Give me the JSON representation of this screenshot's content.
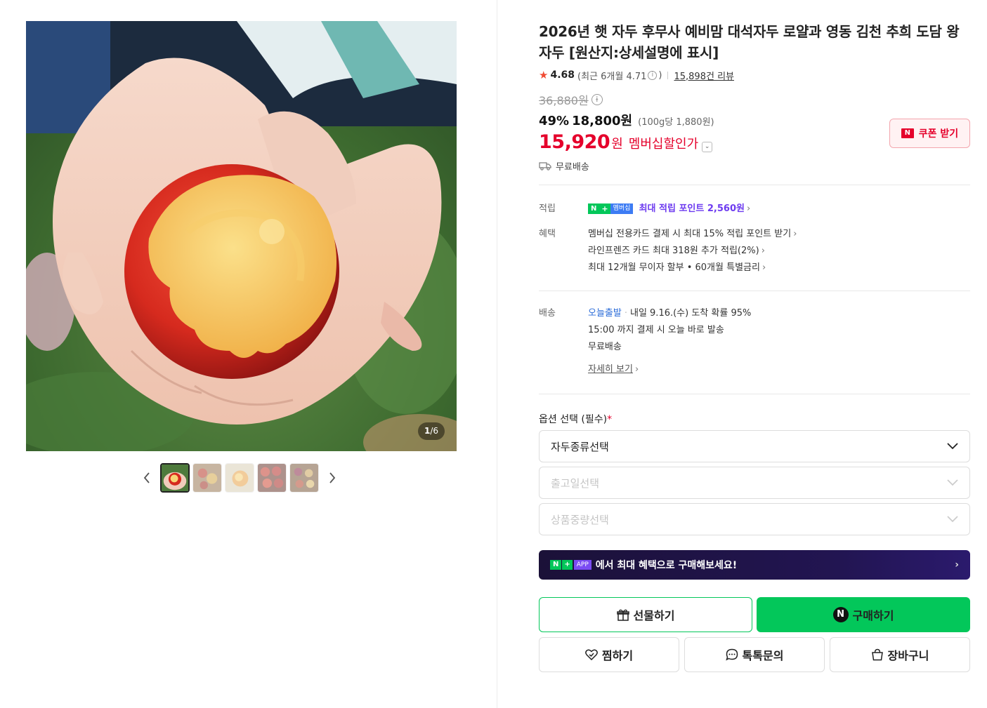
{
  "gallery": {
    "counter_current": "1",
    "counter_total": "/6",
    "thumbnail_count": 5
  },
  "product": {
    "title": "2026년 햇 자두 후무사 예비맘 대석자두 로얄과 영동 김천 추희 도담 왕자두 [원산지:상세설명에 표시]",
    "rating": "4.68",
    "rating_recent": "(최근 6개월 4.71",
    "rating_recent_close": ")",
    "review_count": "15,898건 리뷰",
    "original_price": "36,880원",
    "discount_rate": "49%",
    "sale_price": "18,800원",
    "unit_price": "(100g당 1,880원)",
    "member_price": "15,920",
    "member_won": "원",
    "member_label": "멤버십할인가",
    "shipping_summary": "무료배송",
    "coupon_label": "쿠폰 받기"
  },
  "benefits": {
    "points_label": "적립",
    "points_badge_n": "N",
    "points_badge_plus": "+",
    "points_badge_mem": "멤버십",
    "points_text": "최대 적립 포인트 2,560원",
    "perk_label": "혜택",
    "perks": [
      "멤버십 전용카드 결제 시 최대 15% 적립 포인트 받기",
      "라인프렌즈 카드 최대 318원 추가 적립(2%)",
      "최대 12개월 무이자 할부 • 60개월 특별금리"
    ]
  },
  "delivery": {
    "label": "배송",
    "today": "오늘출발",
    "arrival": "내일 9.16.(수) 도착 확률 95%",
    "cutoff": "15:00 까지 결제 시 오늘 바로 발송",
    "fee": "무료배송",
    "more": "자세히 보기"
  },
  "options": {
    "title": "옵션 선택 (필수)",
    "required_mark": "*",
    "selects": [
      {
        "placeholder": "자두종류선택",
        "enabled": true
      },
      {
        "placeholder": "출고일선택",
        "enabled": false
      },
      {
        "placeholder": "상품중량선택",
        "enabled": false
      }
    ]
  },
  "app_banner": {
    "n": "N",
    "plus": "+",
    "app": "APP",
    "text": "에서 최대 혜택으로 구매해보세요!"
  },
  "actions": {
    "gift": "선물하기",
    "buy": "구매하기",
    "buy_logo": "N",
    "wish": "찜하기",
    "talk": "톡톡문의",
    "cart": "장바구니"
  },
  "colors": {
    "accent_green": "#03c75a",
    "price_red": "#e5002b",
    "point_purple": "#6d3bf0"
  }
}
